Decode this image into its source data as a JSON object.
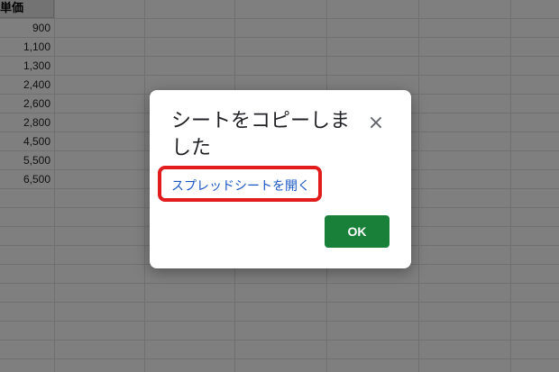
{
  "sheet": {
    "column_header": "単価",
    "values": [
      "900",
      "1,100",
      "1,300",
      "2,400",
      "2,600",
      "2,800",
      "4,500",
      "5,500",
      "6,500"
    ]
  },
  "dialog": {
    "title": "シートをコピーしました",
    "close_icon": "close-icon",
    "close_glyph": "×",
    "link_label": "スプレッドシートを開く",
    "ok_label": "OK"
  },
  "colors": {
    "ok_button": "#188038",
    "link": "#1a57c4",
    "highlight": "#e21c1c"
  }
}
